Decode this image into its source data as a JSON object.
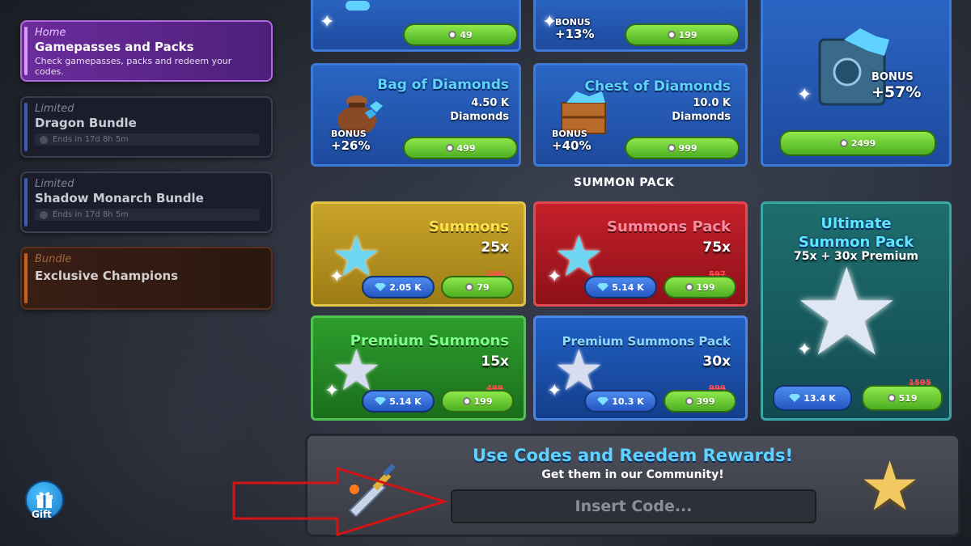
{
  "sidebar": {
    "items": [
      {
        "kind": "Home",
        "name": "Gamepasses and Packs",
        "desc": "Check gamepasses, packs and redeem your codes."
      },
      {
        "kind": "Limited",
        "name": "Dragon Bundle",
        "timer": "Ends in 17d 8h 5m"
      },
      {
        "kind": "Limited",
        "name": "Shadow Monarch Bundle",
        "timer": "Ends in 17d 8h 5m"
      },
      {
        "kind": "Bundle",
        "name": "Exclusive Champions"
      }
    ]
  },
  "gift": {
    "label": "Gift"
  },
  "diamonds": {
    "top_row": [
      {
        "price": "49"
      },
      {
        "bonus_label": "BONUS",
        "bonus": "+13%",
        "price": "199"
      }
    ],
    "bag": {
      "title": "Bag of Diamonds",
      "amount": "4.50 K",
      "unit": "Diamonds",
      "bonus_label": "BONUS",
      "bonus": "+26%",
      "price": "499"
    },
    "chest": {
      "title": "Chest of Diamonds",
      "amount": "10.0 K",
      "unit": "Diamonds",
      "bonus_label": "BONUS",
      "bonus": "+40%",
      "price": "999"
    },
    "vault": {
      "bonus_label": "BONUS",
      "bonus": "+57%",
      "price": "2499"
    }
  },
  "summon_section_label": "SUMMON PACK",
  "summons": [
    {
      "title": "Summons",
      "qty": "25x",
      "gem_price": "2.05 K",
      "old_price": "199",
      "price": "79",
      "title_color": "#ffe14a"
    },
    {
      "title": "Summons Pack",
      "qty": "75x",
      "gem_price": "5.14 K",
      "old_price": "597",
      "price": "199",
      "title_color": "#ff8aa0"
    },
    {
      "title": "Premium Summons",
      "qty": "15x",
      "gem_price": "5.14 K",
      "old_price": "499",
      "price": "199",
      "title_color": "#7dff8a"
    },
    {
      "title": "Premium Summons Pack",
      "qty": "30x",
      "gem_price": "10.3 K",
      "old_price": "999",
      "price": "399",
      "title_color": "#8fd8ff"
    }
  ],
  "ultimate": {
    "title_line1": "Ultimate",
    "title_line2": "Summon Pack",
    "sub": "75x + 30x Premium",
    "gem_price": "13.4 K",
    "old_price": "1595",
    "price": "519"
  },
  "codes": {
    "title": "Use Codes and Reedem Rewards!",
    "subtitle": "Get them in our Community!",
    "placeholder": "Insert Code..."
  },
  "colors": {
    "accent_cyan": "#5fd2ff",
    "home_purple": "#6b2c9c",
    "price_green": "#5cc02c",
    "gem_blue": "#2d62cc",
    "strike_red": "#ff4c4c",
    "arrow_red": "#d41414"
  }
}
